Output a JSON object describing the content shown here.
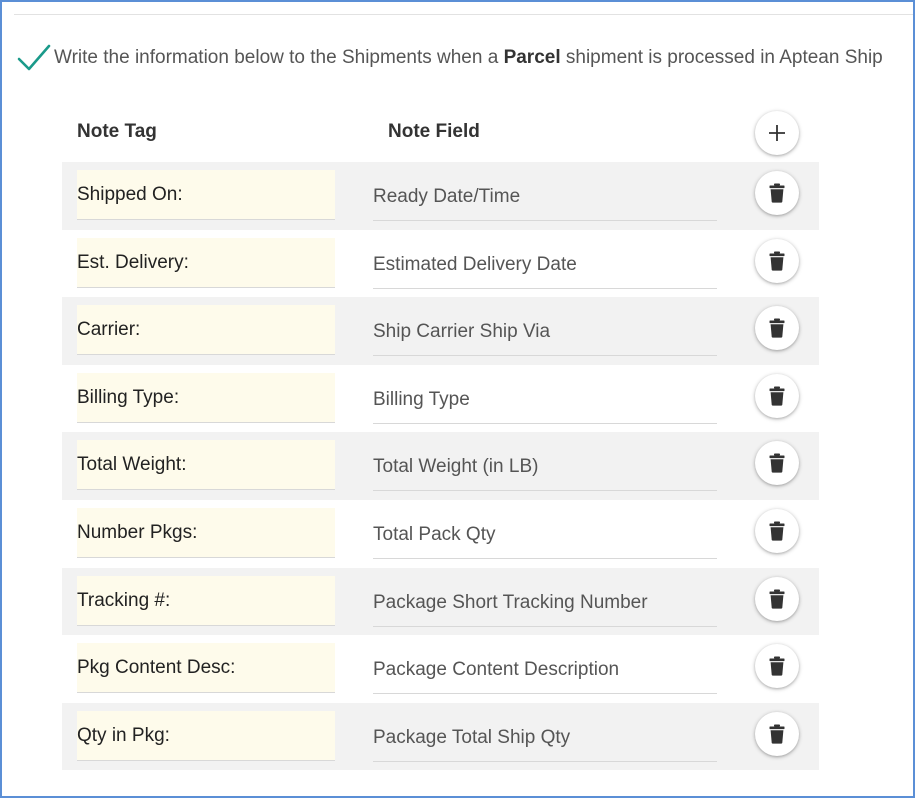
{
  "instruction": {
    "prefix": "Write the information below to the Shipments when a ",
    "bold": "Parcel",
    "suffix": " shipment is processed in Aptean Ship"
  },
  "table": {
    "header_tag": "Note Tag",
    "header_field": "Note Field",
    "add_icon": "plus-icon",
    "delete_icon": "trash-icon",
    "rows": [
      {
        "tag": "Shipped On:",
        "field": "Ready Date/Time"
      },
      {
        "tag": "Est. Delivery:",
        "field": "Estimated Delivery Date"
      },
      {
        "tag": "Carrier:",
        "field": "Ship Carrier Ship Via"
      },
      {
        "tag": "Billing Type:",
        "field": "Billing Type"
      },
      {
        "tag": "Total Weight:",
        "field": "Total Weight (in LB)"
      },
      {
        "tag": "Number Pkgs:",
        "field": "Total Pack Qty"
      },
      {
        "tag": "Tracking #:",
        "field": "Package Short Tracking Number"
      },
      {
        "tag": "Pkg Content Desc:",
        "field": "Package Content Description"
      },
      {
        "tag": "Qty in Pkg:",
        "field": "Package Total Ship Qty"
      }
    ]
  },
  "colors": {
    "check": "#1a9a8a",
    "frame_border": "#5b8fd6",
    "tag_background": "#fefbeb",
    "row_shade": "#f2f2f2"
  }
}
